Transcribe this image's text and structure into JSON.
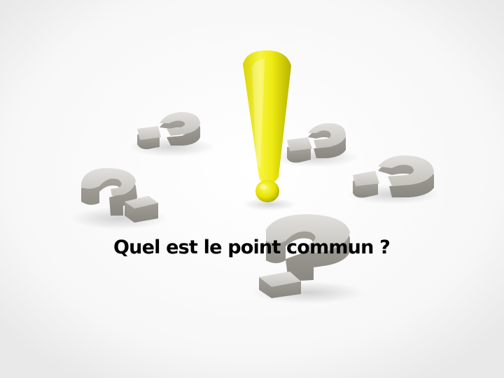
{
  "caption": "Quel est le point commun ?",
  "colors": {
    "background": "#ffffff",
    "exclamation": "#f2ee10",
    "exclamation_shade": "#b5b000",
    "question": "#c9c7c2",
    "question_shade": "#8f8c86",
    "caption": "#000000"
  },
  "icons": {
    "center": "exclamation-mark-icon",
    "around": "question-mark-icon"
  }
}
